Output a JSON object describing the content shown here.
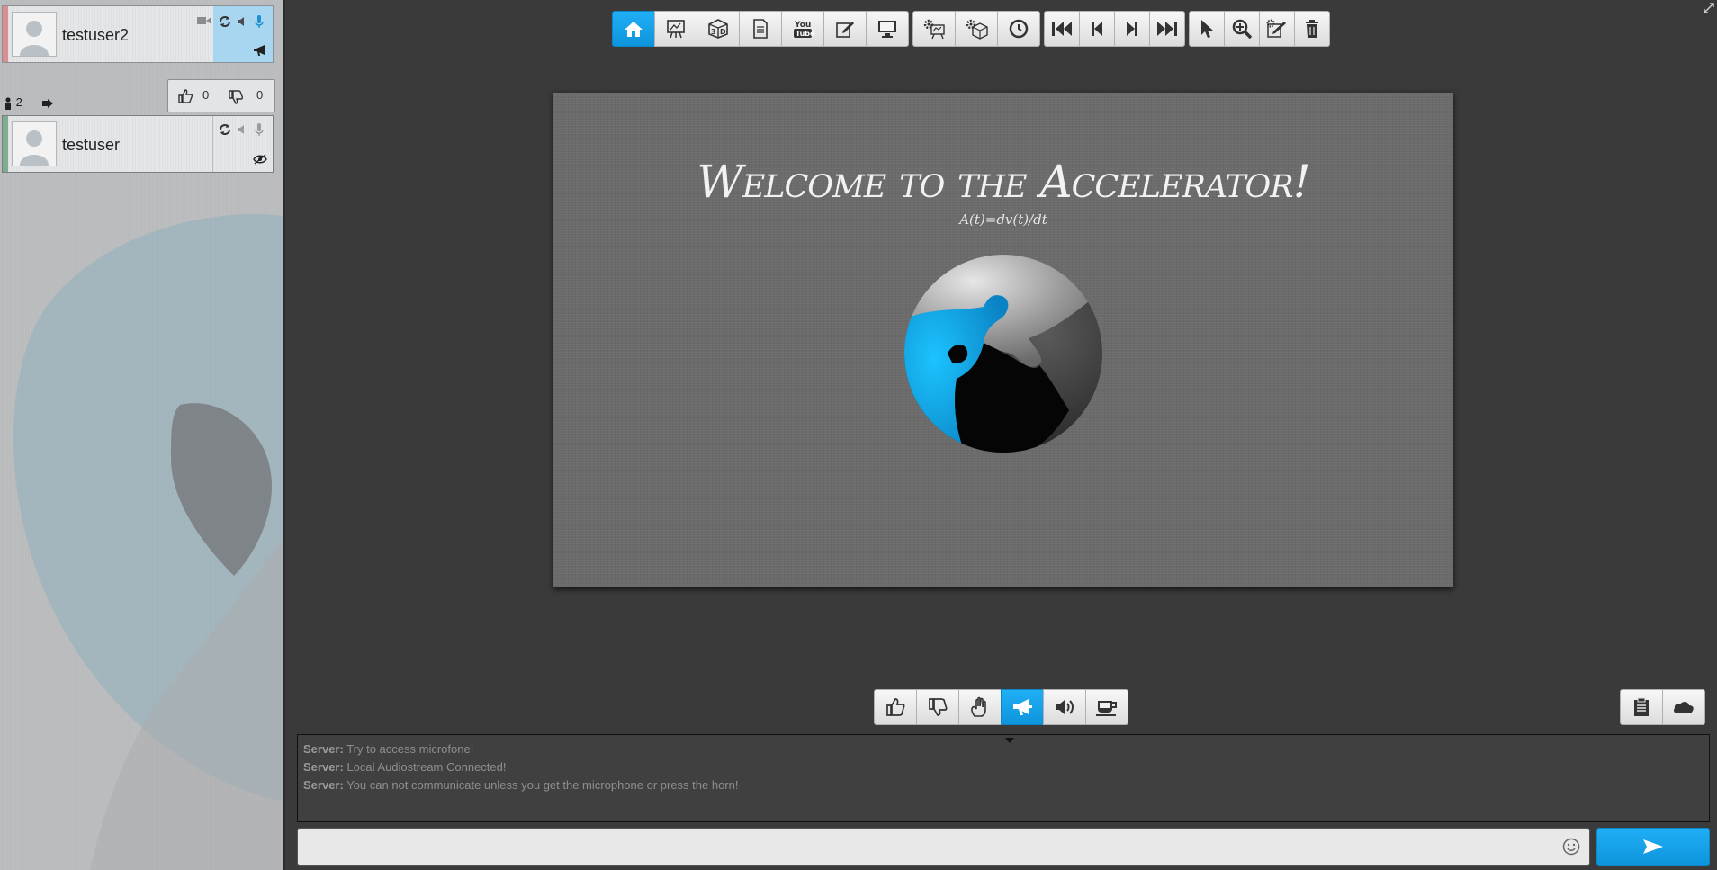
{
  "users": [
    {
      "name": "testuser2",
      "accent": "#d98f8f",
      "panel_color": "#a8d5f0"
    },
    {
      "name": "testuser",
      "accent": "#7fae8f"
    }
  ],
  "votes": {
    "up": "0",
    "down": "0"
  },
  "participants": {
    "count": "2"
  },
  "toolbar": {
    "groups": [
      [
        "home-icon",
        "whiteboard-icon",
        "3d-icon",
        "document-icon",
        "youtube-icon",
        "edit-icon",
        "screen-icon"
      ],
      [
        "whiteboard-settings-icon",
        "3d-settings-icon",
        "clock-icon"
      ],
      [
        "first-icon",
        "prev-icon",
        "next-icon",
        "last-icon"
      ],
      [
        "pointer-icon",
        "zoom-icon",
        "edit-settings-icon",
        "trash-icon"
      ]
    ],
    "active": "home-icon"
  },
  "slide": {
    "title": "Welcome to the Accelerator!",
    "subtitle": "A(t)=dv(t)/dt"
  },
  "reactions": {
    "items": [
      "thumbs-up-icon",
      "thumbs-down-icon",
      "hand-icon",
      "horn-icon",
      "volume-icon",
      "coffee-icon"
    ],
    "active": "horn-icon"
  },
  "chat": {
    "messages": [
      {
        "sender": "Server:",
        "text": "Try to access microfone!"
      },
      {
        "sender": "Server:",
        "text": "Local Audiostream Connected!"
      },
      {
        "sender": "Server:",
        "text": "You can not communicate unless you get the microphone or press the horn!"
      }
    ],
    "input_placeholder": ""
  },
  "colors": {
    "accent": "#1aa3ea",
    "background": "#3a3a3a",
    "sidebar": "#b9bbbc"
  }
}
